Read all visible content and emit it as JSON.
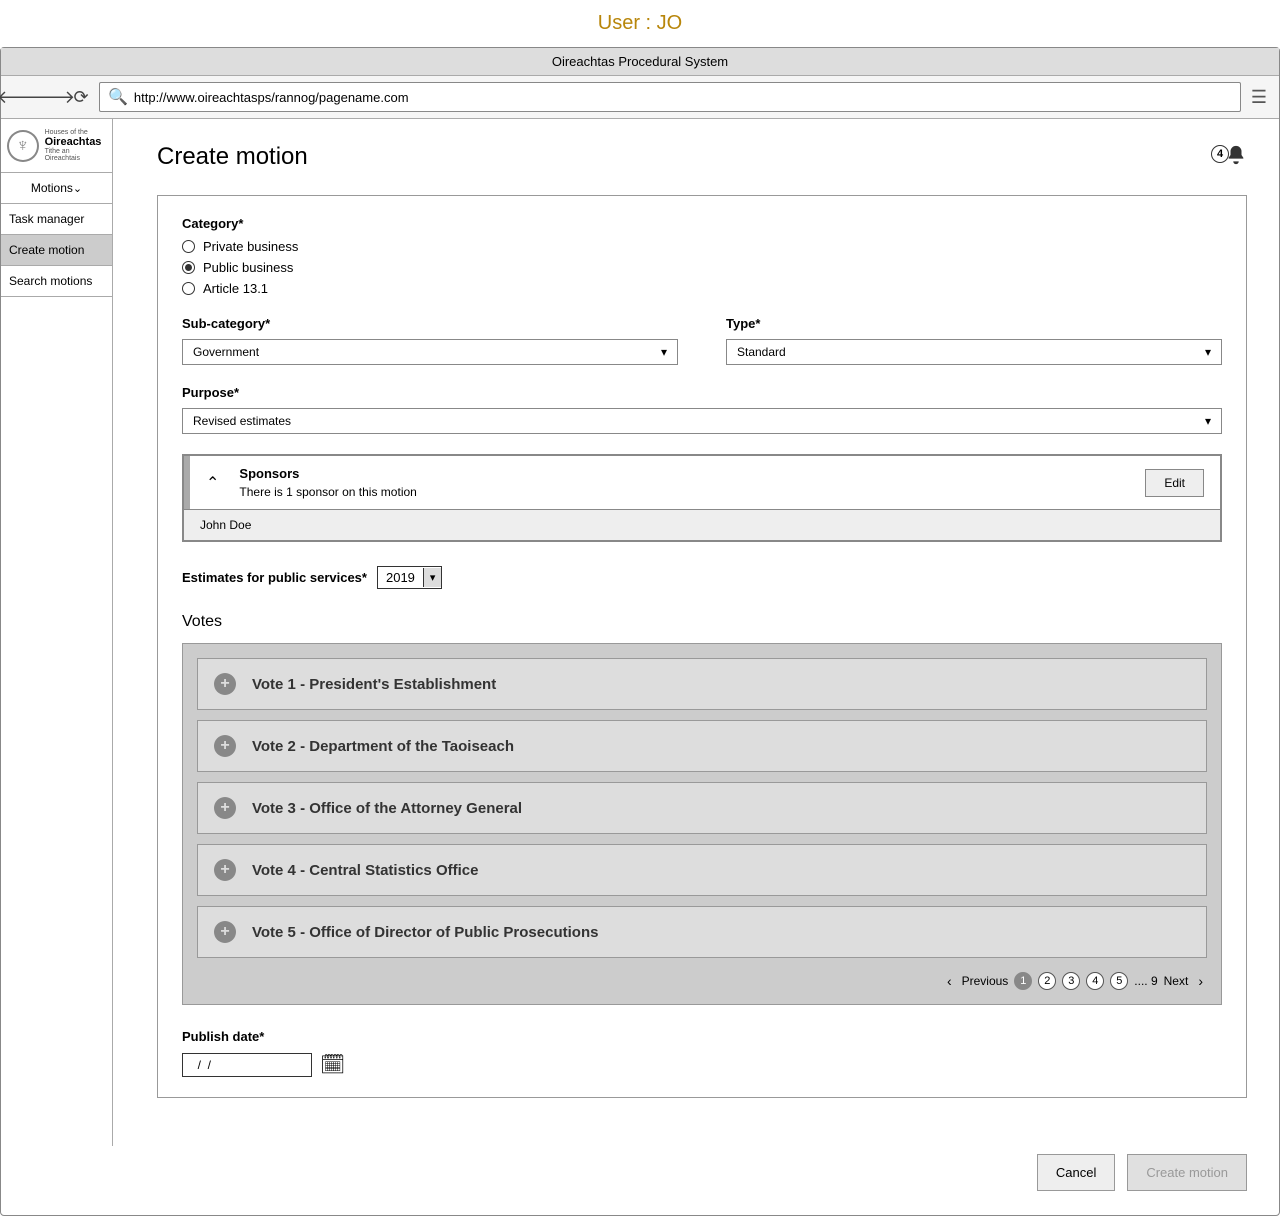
{
  "user_label": "User : JO",
  "window_title": "Oireachtas Procedural System",
  "url": "http://www.oireachtasps/rannog/pagename.com",
  "logo": {
    "sup": "Houses of the",
    "main": "Oireachtas",
    "sub": "Tithe an Oireachtais"
  },
  "sidebar": {
    "items": [
      "Motions",
      "Task manager",
      "Create motion",
      "Search motions"
    ]
  },
  "page_title": "Create motion",
  "notif_count": "4",
  "category": {
    "label": "Category*",
    "options": [
      "Private business",
      "Public business",
      "Article 13.1"
    ],
    "selected": "Public business"
  },
  "subcategory": {
    "label": "Sub-category*",
    "value": "Government"
  },
  "type": {
    "label": "Type*",
    "value": "Standard"
  },
  "purpose": {
    "label": "Purpose*",
    "value": "Revised estimates"
  },
  "sponsors": {
    "title": "Sponsors",
    "subtitle": "There is 1 sponsor on this motion",
    "edit": "Edit",
    "list": [
      "John Doe"
    ]
  },
  "estimates": {
    "label": "Estimates for public services*",
    "year": "2019"
  },
  "votes": {
    "title": "Votes",
    "items": [
      "Vote 1 - President's Establishment",
      "Vote 2 - Department of the Taoiseach",
      "Vote 3 - Office of the Attorney General",
      "Vote 4 - Central Statistics Office",
      "Vote 5 - Office of Director of Public Prosecutions"
    ],
    "pagination": {
      "prev": "Previous",
      "pages": [
        "1",
        "2",
        "3",
        "4",
        "5"
      ],
      "ellipsis": ".... 9",
      "next": "Next"
    }
  },
  "publish": {
    "label": "Publish date*",
    "value": "  /  /"
  },
  "footer": {
    "cancel": "Cancel",
    "create": "Create motion"
  }
}
